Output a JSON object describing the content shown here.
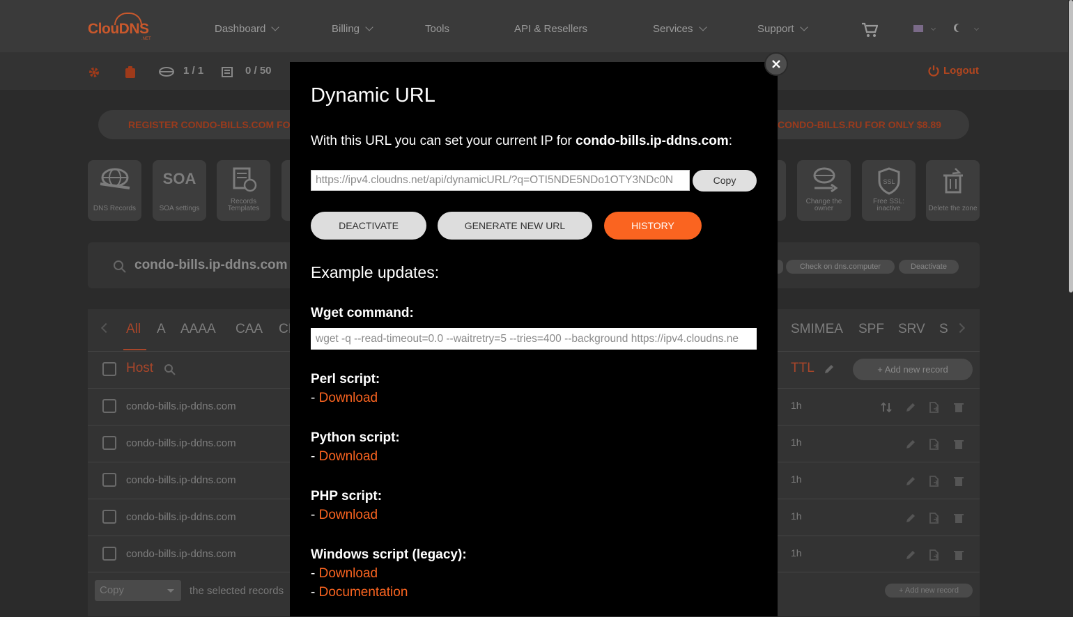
{
  "colors": {
    "accent": "#fa6420",
    "modal_bg": "#000000",
    "page_bg": "#2b2b2b"
  },
  "brand": {
    "logo": "ClouDNS",
    "logo_sub": ".NET"
  },
  "nav": {
    "items": [
      {
        "label": "Dashboard",
        "dropdown": true
      },
      {
        "label": "Billing",
        "dropdown": true
      },
      {
        "label": "Tools",
        "dropdown": false
      },
      {
        "label": "API & Resellers",
        "dropdown": false
      },
      {
        "label": "Services",
        "dropdown": true
      },
      {
        "label": "Support",
        "dropdown": true
      }
    ],
    "cart_icon": "cart-icon",
    "language_icon": "flag-icon",
    "theme_icon": "moon-icon"
  },
  "subbar": {
    "zones_count": "1 / 1",
    "records_count": "0 / 50",
    "logout_label": "Logout"
  },
  "promo": {
    "left": "REGISTER CONDO-BILLS.COM FOR",
    "right": "CONDO-BILLS.RU FOR ONLY $8.89"
  },
  "tools": [
    {
      "label": "DNS Records",
      "icon": "dns-records-icon"
    },
    {
      "label": "SOA settings",
      "icon": "soa-icon",
      "big": "SOA"
    },
    {
      "label": "Records Templates",
      "icon": "records-templates-icon"
    },
    {
      "label": "Change the owner",
      "icon": "change-owner-icon"
    },
    {
      "label": "Free SSL: inactive",
      "icon": "ssl-icon"
    },
    {
      "label": "Delete the zone",
      "icon": "trash-icon"
    }
  ],
  "domain": {
    "name": "condo-bills.ip-ddns.com",
    "check_label": "Check on dns.computer",
    "deactivate_label": "Deactivate"
  },
  "records": {
    "tabs": [
      "All",
      "A",
      "AAAA",
      "CAA",
      "CI",
      "SMIMEA",
      "SPF",
      "SRV",
      "S"
    ],
    "host_header": "Host",
    "ttl_header": "TTL",
    "add_record_label": "+ Add new record",
    "rows": [
      {
        "host": "condo-bills.ip-ddns.com",
        "ttl": "1h"
      },
      {
        "host": "condo-bills.ip-ddns.com",
        "ttl": "1h"
      },
      {
        "host": "condo-bills.ip-ddns.com",
        "ttl": "1h"
      },
      {
        "host": "condo-bills.ip-ddns.com",
        "ttl": "1h"
      },
      {
        "host": "condo-bills.ip-ddns.com",
        "ttl": "1h"
      }
    ],
    "bulk_action": "Copy",
    "bulk_text": "the selected records",
    "add_record_small": "+ Add new record"
  },
  "modal": {
    "title": "Dynamic URL",
    "desc_prefix": "With this URL you can set your current IP for ",
    "desc_domain": "condo-bills.ip-ddns.com",
    "desc_suffix": ":",
    "url": "https://ipv4.cloudns.net/api/dynamicURL/?q=OTI5NDE5NDo1OTY3NDc0N",
    "copy_label": "Copy",
    "buttons": {
      "deactivate": "DEACTIVATE",
      "generate": "GENERATE NEW URL",
      "history": "HISTORY"
    },
    "examples_heading": "Example updates:",
    "wget_label": "Wget command:",
    "wget_cmd": "wget -q --read-timeout=0.0 --waitretry=5 --tries=400 --background https://ipv4.cloudns.ne",
    "perl_label": "Perl script:",
    "python_label": "Python script:",
    "php_label": "PHP script:",
    "windows_label": "Windows script (legacy):",
    "dash": "- ",
    "download": "Download",
    "documentation": "Documentation"
  }
}
